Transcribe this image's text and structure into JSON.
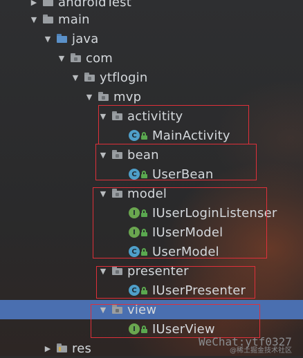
{
  "tree": [
    {
      "label": "androidTest",
      "kind": "folder",
      "expanded": false,
      "icon": "folder-icon"
    },
    {
      "label": "main",
      "kind": "folder",
      "expanded": true,
      "icon": "folder-icon"
    },
    {
      "label": "java",
      "kind": "source-folder",
      "expanded": true,
      "icon": "source-folder-icon"
    },
    {
      "label": "com",
      "kind": "package",
      "expanded": true,
      "icon": "package-icon"
    },
    {
      "label": "ytflogin",
      "kind": "package",
      "expanded": true,
      "icon": "package-icon"
    },
    {
      "label": "mvp",
      "kind": "package",
      "expanded": true,
      "icon": "package-icon"
    },
    {
      "label": "activitity",
      "kind": "package",
      "expanded": true,
      "icon": "package-icon"
    },
    {
      "label": "MainActivity",
      "kind": "class",
      "icon": "class-icon"
    },
    {
      "label": "bean",
      "kind": "package",
      "expanded": true,
      "icon": "package-icon"
    },
    {
      "label": "UserBean",
      "kind": "class",
      "icon": "class-icon"
    },
    {
      "label": "model",
      "kind": "package",
      "expanded": true,
      "icon": "package-icon"
    },
    {
      "label": "IUserLoginListenser",
      "kind": "interface",
      "icon": "interface-icon"
    },
    {
      "label": "IUserModel",
      "kind": "interface",
      "icon": "interface-icon"
    },
    {
      "label": "UserModel",
      "kind": "class",
      "icon": "class-icon"
    },
    {
      "label": "presenter",
      "kind": "package",
      "expanded": true,
      "icon": "package-icon"
    },
    {
      "label": "IUserPresenter",
      "kind": "class",
      "icon": "class-icon"
    },
    {
      "label": "view",
      "kind": "package",
      "expanded": true,
      "selected": true,
      "icon": "package-icon"
    },
    {
      "label": "IUserView",
      "kind": "interface",
      "icon": "interface-icon"
    },
    {
      "label": "res",
      "kind": "resource-folder",
      "expanded": false,
      "icon": "resource-folder-icon"
    }
  ],
  "badges": {
    "class": "C",
    "interface": "I"
  },
  "colors": {
    "selection": "#4a6fb0",
    "highlight_box": "#e0303a",
    "background": "#2b2b2b"
  },
  "watermark": {
    "main": "WeChat:ytf0327",
    "sub": "@稀土掘金技术社区"
  }
}
